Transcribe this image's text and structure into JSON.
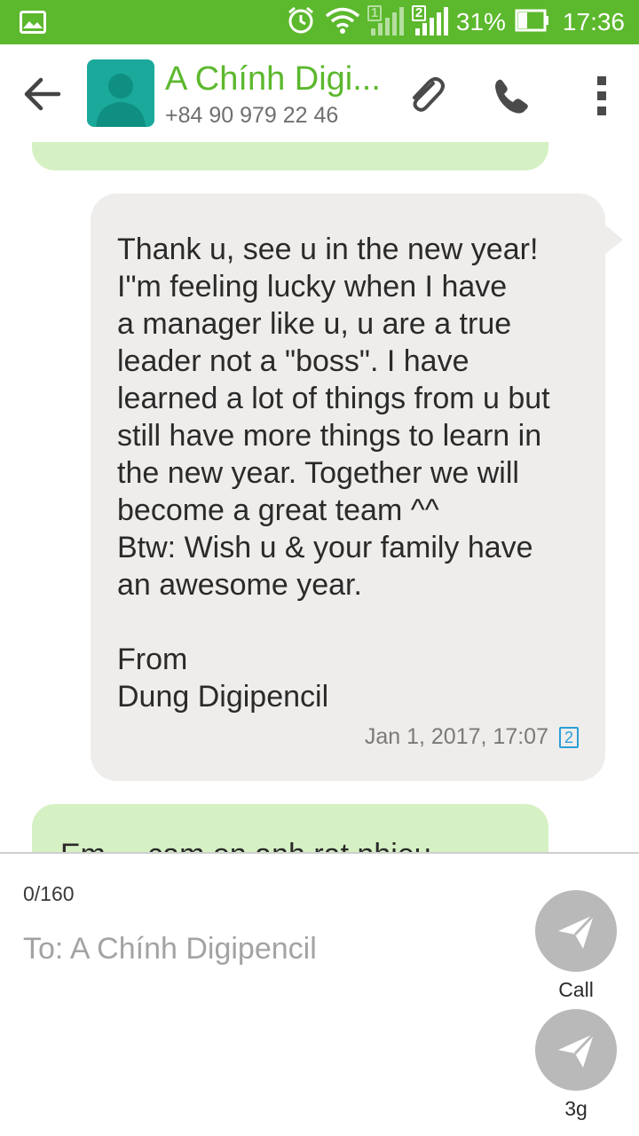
{
  "status_bar": {
    "battery_percent": "31%",
    "time": "17:36",
    "sim1_label": "1",
    "sim2_label": "2",
    "icons": [
      "gallery-icon",
      "alarm-icon",
      "wifi-icon",
      "signal-sim1-icon",
      "signal-sim2-icon",
      "battery-icon"
    ]
  },
  "header": {
    "contact_name": "A Chính Digi...",
    "phone": "+84 90 979 22 46",
    "icons": [
      "back-arrow-icon",
      "contact-avatar-icon",
      "paperclip-icon",
      "phone-icon",
      "more-vert-icon"
    ]
  },
  "conversation": {
    "message": {
      "text": "Thank u, see u in the new year!\nI\"m feeling lucky when I have\na manager like u, u are a true\nleader not a \"boss\". I have\nlearned a lot of things from u but\nstill have more things to learn in\nthe new year. Together we will\nbecome a great team ^^\nBtw: Wish u & your family have\nan awesome year.\n\nFrom\nDung Digipencil",
      "timestamp": "Jan 1, 2017, 17:07",
      "sim_badge": "2"
    },
    "partial_next_text": "Em ... cam on anh rat nhieu..."
  },
  "composer": {
    "char_count": "0/160",
    "placeholder": "To: A Chính Digipencil",
    "send_buttons": [
      {
        "label": "Call"
      },
      {
        "label": "3g"
      }
    ]
  },
  "colors": {
    "accent_green": "#5cb82d",
    "outgoing_bubble": "#d5f1c3",
    "incoming_bubble": "#efedeb",
    "avatar_teal": "#1aa99a",
    "sim_badge_blue": "#2a9fd8"
  }
}
